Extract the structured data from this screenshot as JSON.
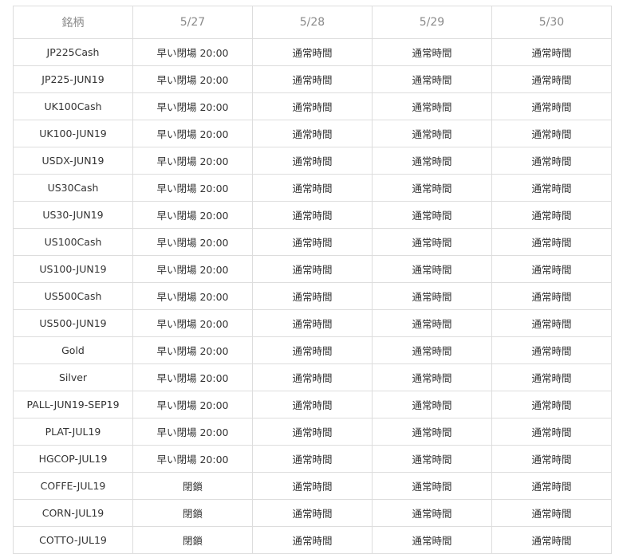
{
  "table": {
    "headers": [
      "銘柄",
      "5/27",
      "5/28",
      "5/29",
      "5/30"
    ],
    "rows": [
      [
        "JP225Cash",
        "早い閉場 20:00",
        "通常時間",
        "通常時間",
        "通常時間"
      ],
      [
        "JP225-JUN19",
        "早い閉場 20:00",
        "通常時間",
        "通常時間",
        "通常時間"
      ],
      [
        "UK100Cash",
        "早い閉場 20:00",
        "通常時間",
        "通常時間",
        "通常時間"
      ],
      [
        "UK100-JUN19",
        "早い閉場 20:00",
        "通常時間",
        "通常時間",
        "通常時間"
      ],
      [
        "USDX-JUN19",
        "早い閉場 20:00",
        "通常時間",
        "通常時間",
        "通常時間"
      ],
      [
        "US30Cash",
        "早い閉場 20:00",
        "通常時間",
        "通常時間",
        "通常時間"
      ],
      [
        "US30-JUN19",
        "早い閉場 20:00",
        "通常時間",
        "通常時間",
        "通常時間"
      ],
      [
        "US100Cash",
        "早い閉場 20:00",
        "通常時間",
        "通常時間",
        "通常時間"
      ],
      [
        "US100-JUN19",
        "早い閉場 20:00",
        "通常時間",
        "通常時間",
        "通常時間"
      ],
      [
        "US500Cash",
        "早い閉場 20:00",
        "通常時間",
        "通常時間",
        "通常時間"
      ],
      [
        "US500-JUN19",
        "早い閉場 20:00",
        "通常時間",
        "通常時間",
        "通常時間"
      ],
      [
        "Gold",
        "早い閉場 20:00",
        "通常時間",
        "通常時間",
        "通常時間"
      ],
      [
        "Silver",
        "早い閉場 20:00",
        "通常時間",
        "通常時間",
        "通常時間"
      ],
      [
        "PALL-JUN19-SEP19",
        "早い閉場 20:00",
        "通常時間",
        "通常時間",
        "通常時間"
      ],
      [
        "PLAT-JUL19",
        "早い閉場 20:00",
        "通常時間",
        "通常時間",
        "通常時間"
      ],
      [
        "HGCOP-JUL19",
        "早い閉場 20:00",
        "通常時間",
        "通常時間",
        "通常時間"
      ],
      [
        "COFFE-JUL19",
        "閉鎖",
        "通常時間",
        "通常時間",
        "通常時間"
      ],
      [
        "CORN-JUL19",
        "閉鎖",
        "通常時間",
        "通常時間",
        "通常時間"
      ],
      [
        "COTTO-JUL19",
        "閉鎖",
        "通常時間",
        "通常時間",
        "通常時間"
      ]
    ]
  }
}
